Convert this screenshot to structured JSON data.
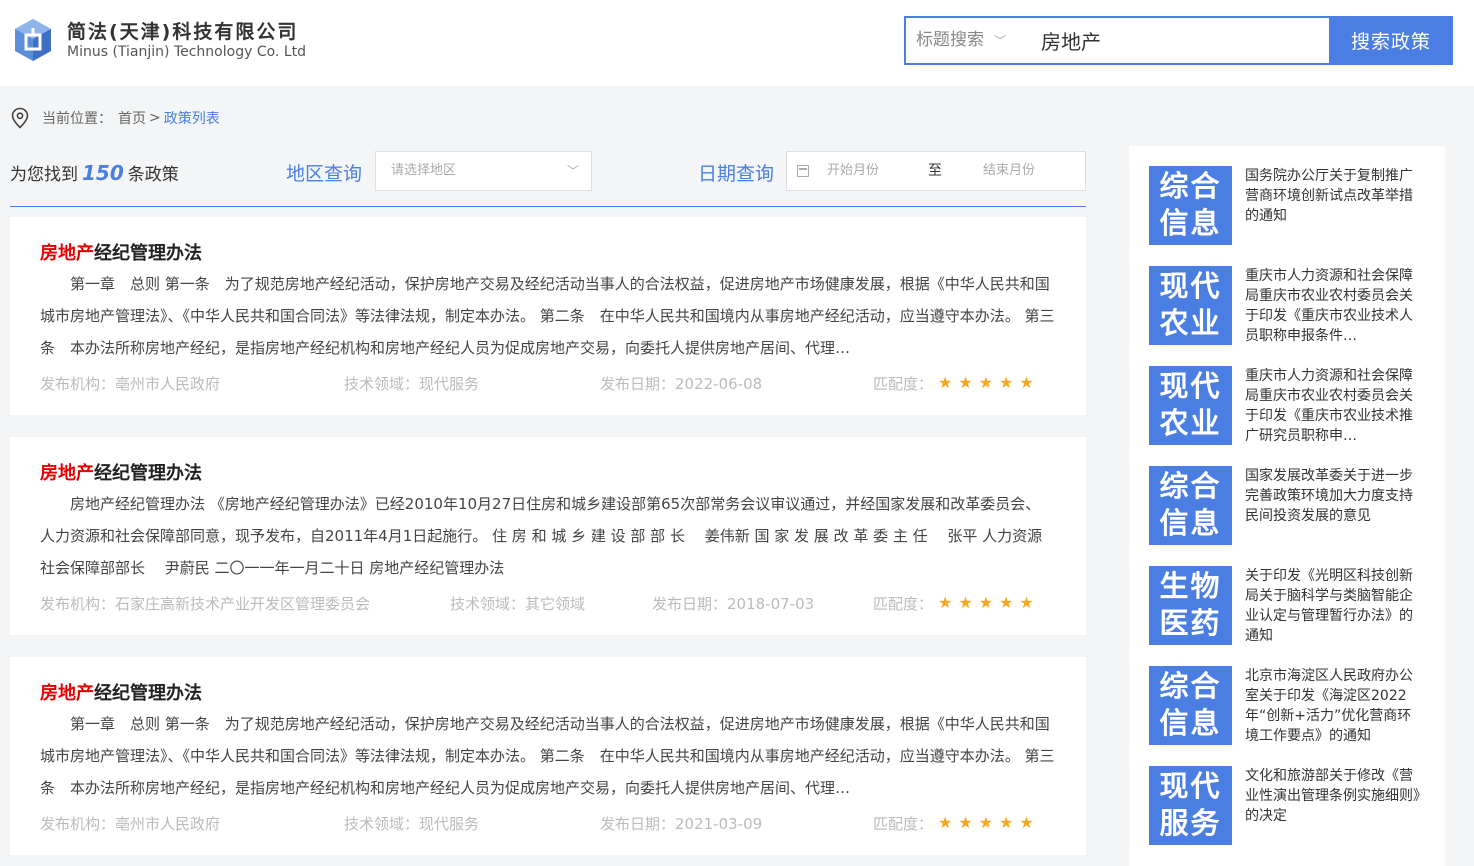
{
  "header": {
    "company_cn": "简法(天津)科技有限公司",
    "company_en": "Minus (Tianjin) Technology Co. Ltd",
    "logo_icon": "cube-logo-icon",
    "search": {
      "type_label": "标题搜索",
      "value": "房地产",
      "button_label": "搜索政策"
    }
  },
  "breadcrumb": {
    "prefix": "当前位置：",
    "home": "首页",
    "separator": ">",
    "current": "政策列表"
  },
  "filter": {
    "found_prefix": "为您找到",
    "found_count": "150",
    "found_suffix": "条政策",
    "region_label": "地区查询",
    "region_placeholder": "请选择地区",
    "date_label": "日期查询",
    "date_start_placeholder": "开始月份",
    "date_to": "至",
    "date_end_placeholder": "结束月份"
  },
  "results": [
    {
      "title_highlight": "房地产",
      "title_rest": "经纪管理办法",
      "body": "第一章　总则 第一条　为了规范房地产经纪活动，保护房地产交易及经纪活动当事人的合法权益，促进房地产市场健康发展，根据《中华人民共和国城市房地产管理法》、《中华人民共和国合同法》等法律法规，制定本办法。 第二条　在中华人民共和国境内从事房地产经纪活动，应当遵守本办法。 第三条　本办法所称房地产经纪，是指房地产经纪机构和房地产经纪人员为促成房地产交易，向委托人提供房地产居间、代理…",
      "agency": "发布机构：亳州市人民政府",
      "field": "技术领域：现代服务",
      "date": "发布日期：2022-06-08",
      "match_label": "匹配度：",
      "stars": "★★★★★"
    },
    {
      "title_highlight": "房地产",
      "title_rest": "经纪管理办法",
      "body": "房地产经纪管理办法 《房地产经纪管理办法》已经2010年10月27日住房和城乡建设部第65次部常务会议审议通过，并经国家发展和改革委员会、人力资源和社会保障部同意，现予发布，自2011年4月1日起施行。 住 房 和 城 乡 建 设 部 部 长　 姜伟新 国 家 发 展 改 革 委 主 任　 张平 人力资源社会保障部部长　 尹蔚民 二〇一一年一月二十日 房地产经纪管理办法",
      "agency": "发布机构：石家庄高新技术产业开发区管理委员会",
      "field": "技术领域：其它领域",
      "date": "发布日期：2018-07-03",
      "match_label": "匹配度：",
      "stars": "★★★★★"
    },
    {
      "title_highlight": "房地产",
      "title_rest": "经纪管理办法",
      "body": "第一章　总则 第一条　为了规范房地产经纪活动，保护房地产交易及经纪活动当事人的合法权益，促进房地产市场健康发展，根据《中华人民共和国城市房地产管理法》、《中华人民共和国合同法》等法律法规，制定本办法。 第二条　在中华人民共和国境内从事房地产经纪活动，应当遵守本办法。 第三条　本办法所称房地产经纪，是指房地产经纪机构和房地产经纪人员为促成房地产交易，向委托人提供房地产居间、代理…",
      "agency": "发布机构：亳州市人民政府",
      "field": "技术领域：现代服务",
      "date": "发布日期：2021-03-09",
      "match_label": "匹配度：",
      "stars": "★★★★★"
    }
  ],
  "sidebar": [
    {
      "tag1": "综合",
      "tag2": "信息",
      "text": "国务院办公厅关于复制推广营商环境创新试点改革举措的通知"
    },
    {
      "tag1": "现代",
      "tag2": "农业",
      "text": "重庆市人力资源和社会保障局重庆市农业农村委员会关于印发《重庆市农业技术人员职称申报条件…"
    },
    {
      "tag1": "现代",
      "tag2": "农业",
      "text": "重庆市人力资源和社会保障局重庆市农业农村委员会关于印发《重庆市农业技术推广研究员职称申…"
    },
    {
      "tag1": "综合",
      "tag2": "信息",
      "text": "国家发展改革委关于进一步完善政策环境加大力度支持民间投资发展的意见"
    },
    {
      "tag1": "生物",
      "tag2": "医药",
      "text": "关于印发《光明区科技创新局关于脑科学与类脑智能企业认定与管理暂行办法》的通知"
    },
    {
      "tag1": "综合",
      "tag2": "信息",
      "text": "北京市海淀区人民政府办公室关于印发《海淀区2022年“创新+活力”优化营商环境工作要点》的通知"
    },
    {
      "tag1": "现代",
      "tag2": "服务",
      "text": "文化和旅游部关于修改《营业性演出管理条例实施细则》的决定"
    }
  ],
  "colors": {
    "accent": "#4a7ee3",
    "highlight": "#e60000",
    "star": "#f5a623"
  }
}
